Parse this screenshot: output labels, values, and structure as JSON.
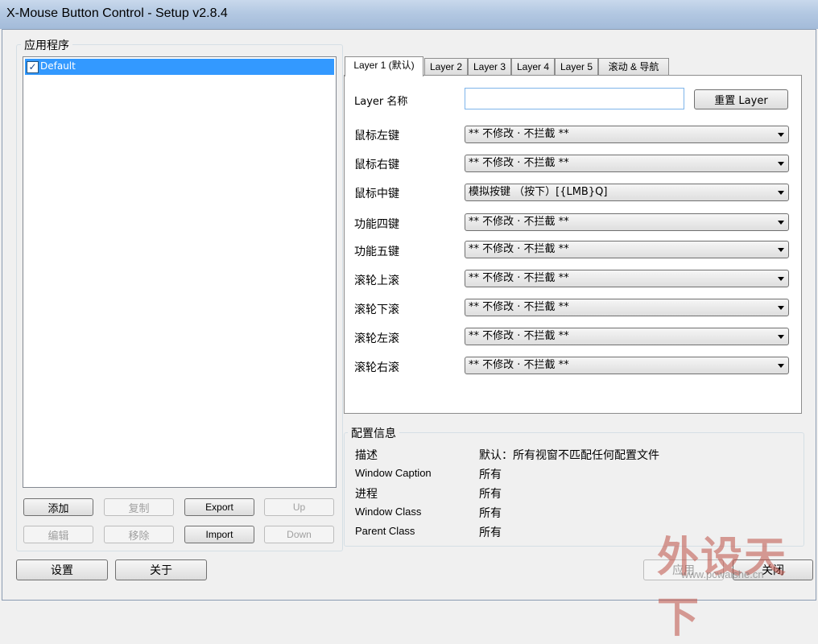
{
  "window": {
    "title": "X-Mouse Button Control - Setup v2.8.4"
  },
  "apps": {
    "group_label": "应用程序",
    "items": [
      {
        "label": "Default",
        "checked": true,
        "selected": true
      }
    ],
    "buttons": {
      "add": "添加",
      "copy": "复制",
      "export": "Export",
      "up": "Up",
      "edit": "编辑",
      "remove": "移除",
      "import": "Import",
      "down": "Down"
    }
  },
  "tabs": [
    "Layer 1 (默认)",
    "Layer 2",
    "Layer 3",
    "Layer 4",
    "Layer 5",
    "滚动 & 导航"
  ],
  "layer": {
    "name_label": "Layer 名称",
    "name_value": "",
    "reset_button": "重置 Layer",
    "rows": [
      {
        "label": "鼠标左键",
        "value": "** 不修改 · 不拦截 **"
      },
      {
        "label": "鼠标右键",
        "value": "** 不修改 · 不拦截 **"
      },
      {
        "label": "鼠标中键",
        "value": "模拟按键 （按下）[{LMB}Q]"
      },
      {
        "label": "功能四键",
        "value": "** 不修改 · 不拦截 **"
      },
      {
        "label": "功能五键",
        "value": "** 不修改 · 不拦截 **"
      },
      {
        "label": "滚轮上滚",
        "value": "** 不修改 · 不拦截 **"
      },
      {
        "label": "滚轮下滚",
        "value": "** 不修改 · 不拦截 **"
      },
      {
        "label": "滚轮左滚",
        "value": "** 不修改 · 不拦截 **"
      },
      {
        "label": "滚轮右滚",
        "value": "** 不修改 · 不拦截 **"
      }
    ]
  },
  "config_info": {
    "group_label": "配置信息",
    "rows": [
      {
        "label": "描述",
        "value": "默认：所有视窗不匹配任何配置文件"
      },
      {
        "label": "Window Caption",
        "value": "所有"
      },
      {
        "label": "进程",
        "value": "所有"
      },
      {
        "label": "Window Class",
        "value": "所有"
      },
      {
        "label": "Parent Class",
        "value": "所有"
      }
    ]
  },
  "bottom": {
    "settings": "设置",
    "about": "关于",
    "apply": "应用",
    "close": "关闭"
  },
  "watermark": {
    "text": "外设天下",
    "url": "www.pcwaishe.cn"
  },
  "colors": {
    "selection": "#3399ff",
    "titlebar": "#b3c8e2"
  }
}
